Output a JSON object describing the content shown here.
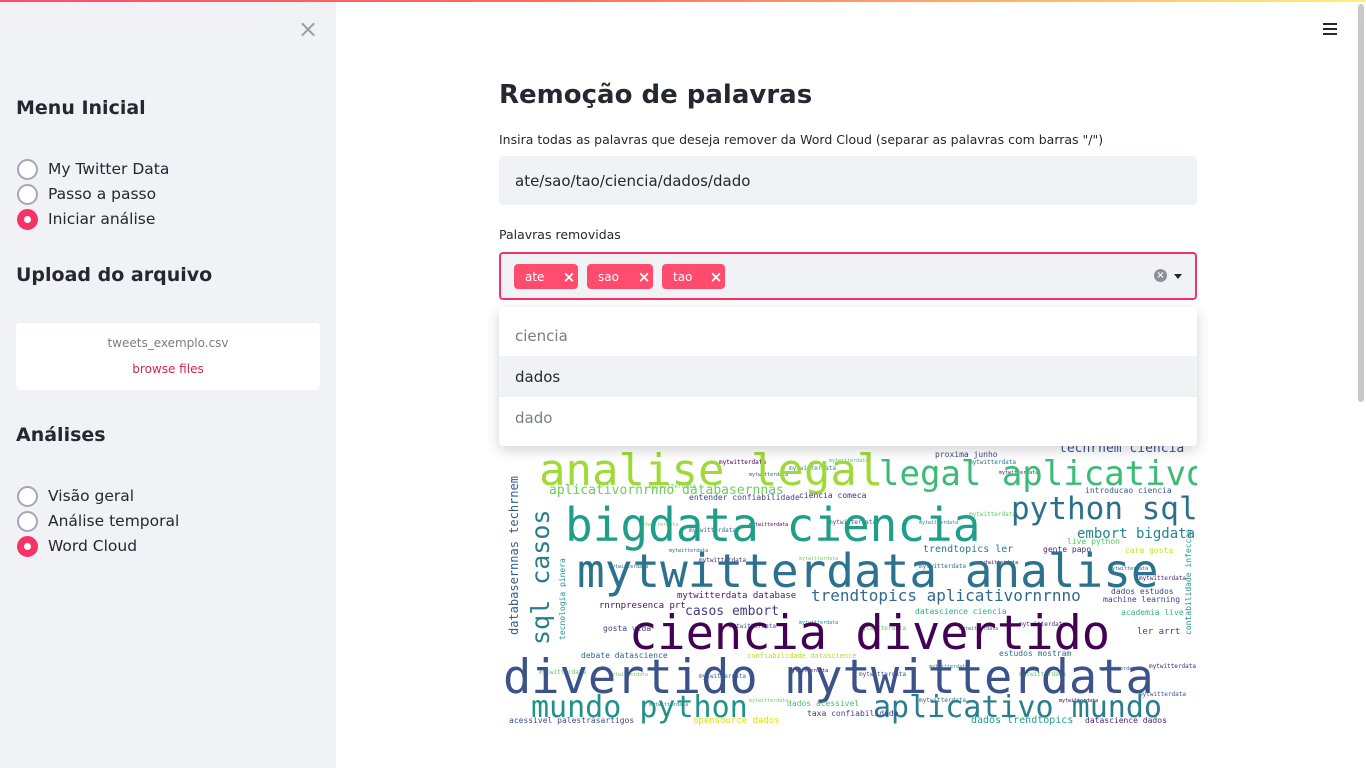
{
  "sidebar": {
    "close_icon": "×",
    "menu_heading": "Menu Inicial",
    "menu_options": [
      "My Twitter Data",
      "Passo a passo",
      "Iniciar análise"
    ],
    "menu_selected": "Iniciar análise",
    "upload_heading": "Upload do arquivo",
    "upload_filename": "tweets_exemplo.csv",
    "upload_browse": "browse files",
    "analyses_heading": "Análises",
    "analyses_options": [
      "Visão geral",
      "Análise temporal",
      "Word Cloud"
    ],
    "analyses_selected": "Word Cloud"
  },
  "main": {
    "title": "Remoção de palavras",
    "input_label": "Insira todas as palavras que deseja remover da Word Cloud (separar as palavras com barras \"/\")",
    "input_value": "ate/sao/tao/ciencia/dados/dado",
    "multiselect_label": "Palavras removidas",
    "tags": [
      "ate",
      "sao",
      "tao"
    ],
    "dropdown_options": [
      "ciencia",
      "dados",
      "dado"
    ],
    "dropdown_highlighted": "dados"
  },
  "wordcloud": {
    "words": [
      {
        "text": "analise legal",
        "color": "#a0da39"
      },
      {
        "text": "legal aplicativo",
        "color": "#3bbb75"
      },
      {
        "text": "python sql",
        "color": "#2d708e"
      },
      {
        "text": "bigdata ciencia",
        "color": "#1f9e89"
      },
      {
        "text": "mytwitterdata analise",
        "color": "#2c728e"
      },
      {
        "text": "ciencia divertido",
        "color": "#440154"
      },
      {
        "text": "divertido mytwitterdata",
        "color": "#3b528b"
      },
      {
        "text": "mundo python",
        "color": "#21918c"
      },
      {
        "text": "aplicativo mundo",
        "color": "#287d8e"
      },
      {
        "text": "sql casos",
        "color": "#277f8e"
      },
      {
        "text": "databasernnas techrnem",
        "color": "#355f8d"
      },
      {
        "text": "aplicativornrnno databasernnas",
        "color": "#6ccd5a"
      },
      {
        "text": "trendtopics aplicativornrnno",
        "color": "#31688e"
      },
      {
        "text": "casos embort",
        "color": "#443a83"
      },
      {
        "text": "embort bigdata",
        "color": "#25858e"
      },
      {
        "text": "techrnem ciencia",
        "color": "#39568c"
      },
      {
        "text": "entender confiabilidade",
        "color": "#404688"
      },
      {
        "text": "ciencia comeca",
        "color": "#46327e"
      },
      {
        "text": "proxima junho",
        "color": "#3e4989"
      },
      {
        "text": "introducao ciencia",
        "color": "#375a8c"
      },
      {
        "text": "trendtopics ler",
        "color": "#2a788e"
      },
      {
        "text": "mytwitterdata database",
        "color": "#48186a"
      },
      {
        "text": "rnrnpresenca prt",
        "color": "#471063"
      },
      {
        "text": "tecnologia pinera",
        "color": "#1f968b"
      },
      {
        "text": "dados estudos",
        "color": "#414487"
      },
      {
        "text": "machine learning",
        "color": "#3f4788"
      },
      {
        "text": "academia live",
        "color": "#2fb47c"
      },
      {
        "text": "ler arrt",
        "color": "#453781"
      },
      {
        "text": "estudos mostram",
        "color": "#2e6f8e"
      },
      {
        "text": "gosta vida",
        "color": "#424086"
      },
      {
        "text": "debate datascience",
        "color": "#33638d"
      },
      {
        "text": "confiabilidade datascience",
        "color": "#b5de2b"
      },
      {
        "text": "datascience ciencia",
        "color": "#2ab07f"
      },
      {
        "text": "opensource dados",
        "color": "#d8e219"
      },
      {
        "text": "dados trendtopics",
        "color": "#1fa088"
      },
      {
        "text": "datascience dados",
        "color": "#482576"
      },
      {
        "text": "acessivel palestrasartigos",
        "color": "#3e4a89"
      },
      {
        "text": "taxa confiabilidade",
        "color": "#433e85"
      },
      {
        "text": "dados acessivel",
        "color": "#4ac16d"
      },
      {
        "text": "gente papo",
        "color": "#472c7a"
      },
      {
        "text": "live python",
        "color": "#52c569"
      },
      {
        "text": "cara gosta",
        "color": "#d0e11c"
      },
      {
        "text": "contabilidade infeccao",
        "color": "#20928c"
      }
    ]
  }
}
